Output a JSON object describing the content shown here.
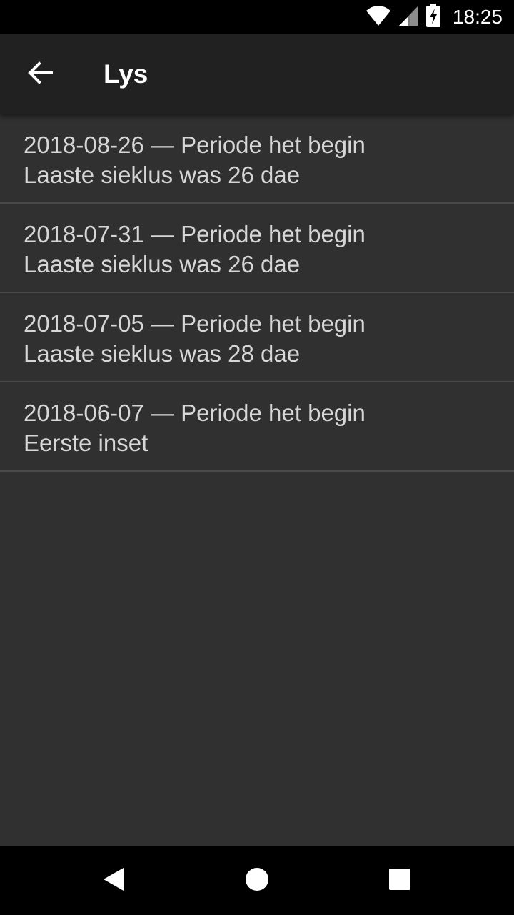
{
  "status_bar": {
    "time": "18:25",
    "icons": [
      "wifi-icon",
      "cell-signal-icon",
      "battery-charging-icon"
    ]
  },
  "app_bar": {
    "back_icon": "arrow-back-icon",
    "title": "Lys"
  },
  "list": {
    "items": [
      {
        "line1": "2018-08-26 — Periode het begin",
        "line2": "Laaste sieklus was 26 dae"
      },
      {
        "line1": "2018-07-31 — Periode het begin",
        "line2": "Laaste sieklus was 26 dae"
      },
      {
        "line1": "2018-07-05 — Periode het begin",
        "line2": "Laaste sieklus was 28 dae"
      },
      {
        "line1": "2018-06-07 — Periode het begin",
        "line2": "Eerste inset"
      }
    ]
  },
  "nav_bar": {
    "icons": [
      "nav-back-icon",
      "nav-home-icon",
      "nav-recents-icon"
    ]
  },
  "colors": {
    "background": "#303030",
    "app_bar": "#212121",
    "text": "#d6d6d6",
    "divider": "#4a4a4a"
  }
}
